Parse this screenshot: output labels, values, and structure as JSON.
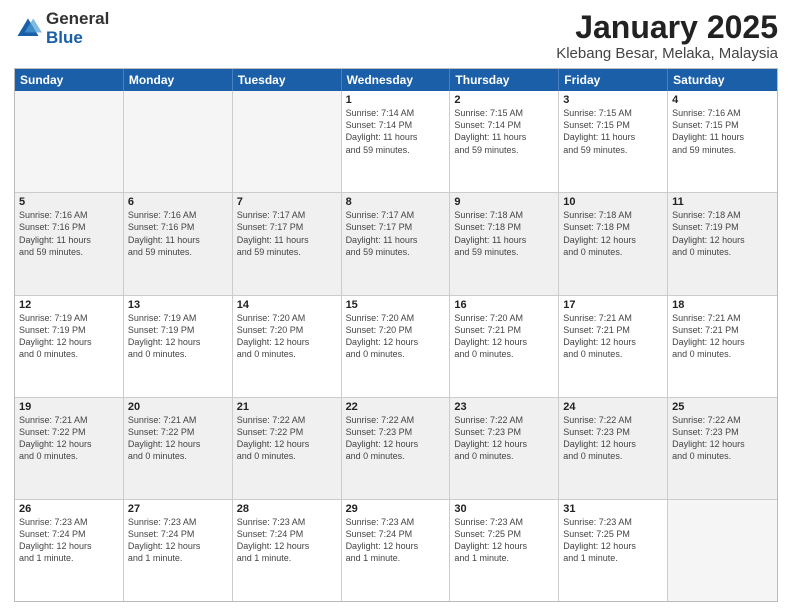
{
  "logo": {
    "general": "General",
    "blue": "Blue"
  },
  "title": "January 2025",
  "subtitle": "Klebang Besar, Melaka, Malaysia",
  "weekdays": [
    "Sunday",
    "Monday",
    "Tuesday",
    "Wednesday",
    "Thursday",
    "Friday",
    "Saturday"
  ],
  "rows": [
    [
      {
        "day": "",
        "info": "",
        "empty": true
      },
      {
        "day": "",
        "info": "",
        "empty": true
      },
      {
        "day": "",
        "info": "",
        "empty": true
      },
      {
        "day": "1",
        "info": "Sunrise: 7:14 AM\nSunset: 7:14 PM\nDaylight: 11 hours\nand 59 minutes."
      },
      {
        "day": "2",
        "info": "Sunrise: 7:15 AM\nSunset: 7:14 PM\nDaylight: 11 hours\nand 59 minutes."
      },
      {
        "day": "3",
        "info": "Sunrise: 7:15 AM\nSunset: 7:15 PM\nDaylight: 11 hours\nand 59 minutes."
      },
      {
        "day": "4",
        "info": "Sunrise: 7:16 AM\nSunset: 7:15 PM\nDaylight: 11 hours\nand 59 minutes."
      }
    ],
    [
      {
        "day": "5",
        "info": "Sunrise: 7:16 AM\nSunset: 7:16 PM\nDaylight: 11 hours\nand 59 minutes."
      },
      {
        "day": "6",
        "info": "Sunrise: 7:16 AM\nSunset: 7:16 PM\nDaylight: 11 hours\nand 59 minutes."
      },
      {
        "day": "7",
        "info": "Sunrise: 7:17 AM\nSunset: 7:17 PM\nDaylight: 11 hours\nand 59 minutes."
      },
      {
        "day": "8",
        "info": "Sunrise: 7:17 AM\nSunset: 7:17 PM\nDaylight: 11 hours\nand 59 minutes."
      },
      {
        "day": "9",
        "info": "Sunrise: 7:18 AM\nSunset: 7:18 PM\nDaylight: 11 hours\nand 59 minutes."
      },
      {
        "day": "10",
        "info": "Sunrise: 7:18 AM\nSunset: 7:18 PM\nDaylight: 12 hours\nand 0 minutes."
      },
      {
        "day": "11",
        "info": "Sunrise: 7:18 AM\nSunset: 7:19 PM\nDaylight: 12 hours\nand 0 minutes."
      }
    ],
    [
      {
        "day": "12",
        "info": "Sunrise: 7:19 AM\nSunset: 7:19 PM\nDaylight: 12 hours\nand 0 minutes."
      },
      {
        "day": "13",
        "info": "Sunrise: 7:19 AM\nSunset: 7:19 PM\nDaylight: 12 hours\nand 0 minutes."
      },
      {
        "day": "14",
        "info": "Sunrise: 7:20 AM\nSunset: 7:20 PM\nDaylight: 12 hours\nand 0 minutes."
      },
      {
        "day": "15",
        "info": "Sunrise: 7:20 AM\nSunset: 7:20 PM\nDaylight: 12 hours\nand 0 minutes."
      },
      {
        "day": "16",
        "info": "Sunrise: 7:20 AM\nSunset: 7:21 PM\nDaylight: 12 hours\nand 0 minutes."
      },
      {
        "day": "17",
        "info": "Sunrise: 7:21 AM\nSunset: 7:21 PM\nDaylight: 12 hours\nand 0 minutes."
      },
      {
        "day": "18",
        "info": "Sunrise: 7:21 AM\nSunset: 7:21 PM\nDaylight: 12 hours\nand 0 minutes."
      }
    ],
    [
      {
        "day": "19",
        "info": "Sunrise: 7:21 AM\nSunset: 7:22 PM\nDaylight: 12 hours\nand 0 minutes."
      },
      {
        "day": "20",
        "info": "Sunrise: 7:21 AM\nSunset: 7:22 PM\nDaylight: 12 hours\nand 0 minutes."
      },
      {
        "day": "21",
        "info": "Sunrise: 7:22 AM\nSunset: 7:22 PM\nDaylight: 12 hours\nand 0 minutes."
      },
      {
        "day": "22",
        "info": "Sunrise: 7:22 AM\nSunset: 7:23 PM\nDaylight: 12 hours\nand 0 minutes."
      },
      {
        "day": "23",
        "info": "Sunrise: 7:22 AM\nSunset: 7:23 PM\nDaylight: 12 hours\nand 0 minutes."
      },
      {
        "day": "24",
        "info": "Sunrise: 7:22 AM\nSunset: 7:23 PM\nDaylight: 12 hours\nand 0 minutes."
      },
      {
        "day": "25",
        "info": "Sunrise: 7:22 AM\nSunset: 7:23 PM\nDaylight: 12 hours\nand 0 minutes."
      }
    ],
    [
      {
        "day": "26",
        "info": "Sunrise: 7:23 AM\nSunset: 7:24 PM\nDaylight: 12 hours\nand 1 minute."
      },
      {
        "day": "27",
        "info": "Sunrise: 7:23 AM\nSunset: 7:24 PM\nDaylight: 12 hours\nand 1 minute."
      },
      {
        "day": "28",
        "info": "Sunrise: 7:23 AM\nSunset: 7:24 PM\nDaylight: 12 hours\nand 1 minute."
      },
      {
        "day": "29",
        "info": "Sunrise: 7:23 AM\nSunset: 7:24 PM\nDaylight: 12 hours\nand 1 minute."
      },
      {
        "day": "30",
        "info": "Sunrise: 7:23 AM\nSunset: 7:25 PM\nDaylight: 12 hours\nand 1 minute."
      },
      {
        "day": "31",
        "info": "Sunrise: 7:23 AM\nSunset: 7:25 PM\nDaylight: 12 hours\nand 1 minute."
      },
      {
        "day": "",
        "info": "",
        "empty": true
      }
    ]
  ]
}
